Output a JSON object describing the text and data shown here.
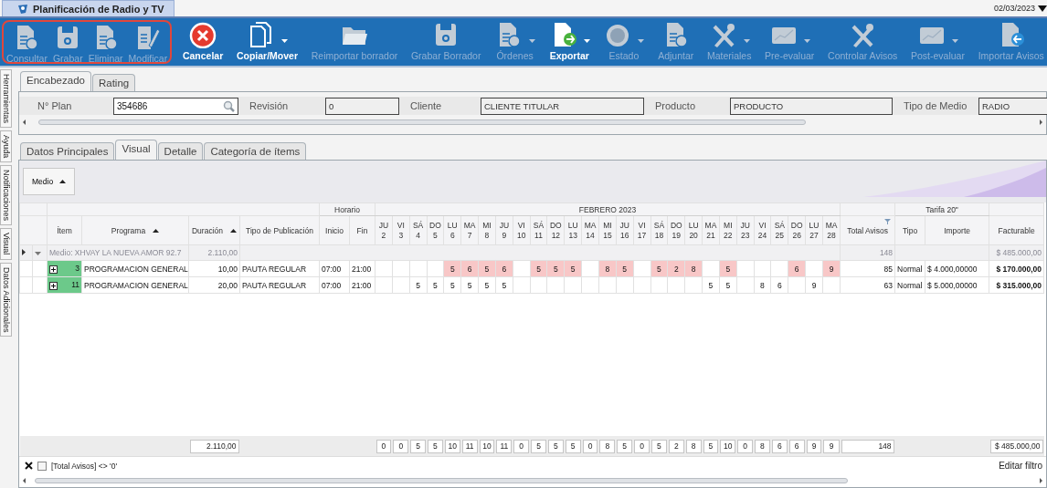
{
  "window": {
    "title": "Planificación de Radio y TV",
    "date": "02/03/2023"
  },
  "toolbar": [
    {
      "label": "Consultar",
      "enabled": false,
      "dropdown": false,
      "highlighted": true
    },
    {
      "label": "Grabar",
      "enabled": false,
      "dropdown": false,
      "highlighted": true
    },
    {
      "label": "Eliminar",
      "enabled": false,
      "dropdown": false,
      "highlighted": true
    },
    {
      "label": "Modificar",
      "enabled": false,
      "dropdown": false,
      "highlighted": true
    },
    {
      "label": "Cancelar",
      "enabled": true,
      "dropdown": false,
      "highlighted": false
    },
    {
      "label": "Copiar/Mover",
      "enabled": true,
      "dropdown": true,
      "highlighted": false
    },
    {
      "label": "Reimportar borrador",
      "enabled": false,
      "dropdown": false,
      "highlighted": false
    },
    {
      "label": "Grabar Borrador",
      "enabled": false,
      "dropdown": false,
      "highlighted": false
    },
    {
      "label": "Órdenes",
      "enabled": false,
      "dropdown": true,
      "highlighted": false
    },
    {
      "label": "Exportar",
      "enabled": true,
      "dropdown": true,
      "highlighted": false
    },
    {
      "label": "Estado",
      "enabled": false,
      "dropdown": true,
      "highlighted": false
    },
    {
      "label": "Adjuntar",
      "enabled": false,
      "dropdown": false,
      "highlighted": false
    },
    {
      "label": "Materiales",
      "enabled": false,
      "dropdown": true,
      "highlighted": false
    },
    {
      "label": "Pre-evaluar",
      "enabled": false,
      "dropdown": true,
      "highlighted": false
    },
    {
      "label": "Controlar Avisos",
      "enabled": false,
      "dropdown": false,
      "highlighted": false
    },
    {
      "label": "Post-evaluar",
      "enabled": false,
      "dropdown": true,
      "highlighted": false
    },
    {
      "label": "Importar Avisos",
      "enabled": false,
      "dropdown": false,
      "highlighted": false
    }
  ],
  "side_tabs": [
    "Herramientas",
    "Ayuda",
    "Notificaciones",
    "Visual",
    "Datos Adicionales"
  ],
  "header_tabs": [
    {
      "label": "Encabezado",
      "selected": true
    },
    {
      "label": "Rating",
      "selected": false
    }
  ],
  "header_fields": [
    {
      "label": "N° Plan",
      "value": "354686",
      "editable": true
    },
    {
      "label": "Revisión",
      "value": "0",
      "editable": false
    },
    {
      "label": "Cliente",
      "value": "CLIENTE TITULAR",
      "editable": false
    },
    {
      "label": "Producto",
      "value": "PRODUCTO",
      "editable": false
    },
    {
      "label": "Tipo de Medio",
      "value": "RADIO",
      "editable": false
    }
  ],
  "detail_tabs": [
    {
      "label": "Datos Principales",
      "selected": false
    },
    {
      "label": "Visual",
      "selected": true
    },
    {
      "label": "Detalle",
      "selected": false
    },
    {
      "label": "Categoría de ítems",
      "selected": false
    }
  ],
  "grid": {
    "group_button": {
      "label": "Medio",
      "sorted": true
    },
    "bands": {
      "horario": "Horario",
      "month": "FEBRERO 2023",
      "tarifa": "Tarifa 20\""
    },
    "lead_columns": [
      {
        "label": "Ítem",
        "sorted": false
      },
      {
        "label": "Programa",
        "sorted": true
      },
      {
        "label": "Duración",
        "sorted": true
      },
      {
        "label": "Tipo de Publicación",
        "sorted": false
      },
      {
        "label": "Inicio",
        "sorted": false
      },
      {
        "label": "Fin",
        "sorted": false
      }
    ],
    "days": [
      {
        "weekday": "JU",
        "day": "2"
      },
      {
        "weekday": "VI",
        "day": "3"
      },
      {
        "weekday": "SÁ",
        "day": "4"
      },
      {
        "weekday": "DO",
        "day": "5"
      },
      {
        "weekday": "LU",
        "day": "6"
      },
      {
        "weekday": "MA",
        "day": "7"
      },
      {
        "weekday": "MI",
        "day": "8"
      },
      {
        "weekday": "JU",
        "day": "9"
      },
      {
        "weekday": "VI",
        "day": "10"
      },
      {
        "weekday": "SÁ",
        "day": "11"
      },
      {
        "weekday": "DO",
        "day": "12"
      },
      {
        "weekday": "LU",
        "day": "13"
      },
      {
        "weekday": "MA",
        "day": "14"
      },
      {
        "weekday": "MI",
        "day": "15"
      },
      {
        "weekday": "JU",
        "day": "16"
      },
      {
        "weekday": "VI",
        "day": "17"
      },
      {
        "weekday": "SÁ",
        "day": "18"
      },
      {
        "weekday": "DO",
        "day": "19"
      },
      {
        "weekday": "LU",
        "day": "20"
      },
      {
        "weekday": "MA",
        "day": "21"
      },
      {
        "weekday": "MI",
        "day": "22"
      },
      {
        "weekday": "JU",
        "day": "23"
      },
      {
        "weekday": "VI",
        "day": "24"
      },
      {
        "weekday": "SÁ",
        "day": "25"
      },
      {
        "weekday": "DO",
        "day": "26"
      },
      {
        "weekday": "LU",
        "day": "27"
      },
      {
        "weekday": "MA",
        "day": "28"
      }
    ],
    "trail_columns": [
      {
        "label": "Total Avisos",
        "filtered": true
      },
      {
        "label": "Tipo",
        "filtered": false
      },
      {
        "label": "Importe",
        "filtered": false
      },
      {
        "label": "Facturable",
        "filtered": false
      }
    ],
    "group": {
      "label": "Medio: XHVAY LA NUEVA AMOR 92.7",
      "duracion": "2.110,00",
      "total_avisos": "148",
      "facturable": "$ 485.000,00",
      "expanded": true,
      "current": true
    },
    "rows": [
      {
        "item": "3",
        "programa": "PROGRAMACION GENERAL",
        "duracion": "10,00",
        "tipo_publicacion": "PAUTA REGULAR",
        "inicio": "07:00",
        "fin": "21:00",
        "days": [
          {
            "highlighted": false
          },
          {
            "highlighted": false
          },
          {
            "highlighted": false
          },
          {
            "highlighted": false
          },
          {
            "value": "5",
            "highlighted": true
          },
          {
            "value": "6",
            "highlighted": true
          },
          {
            "value": "5",
            "highlighted": true
          },
          {
            "value": "6",
            "highlighted": true
          },
          {
            "highlighted": false
          },
          {
            "value": "5",
            "highlighted": true
          },
          {
            "value": "5",
            "highlighted": true
          },
          {
            "value": "5",
            "highlighted": true
          },
          {
            "highlighted": false
          },
          {
            "value": "8",
            "highlighted": true
          },
          {
            "value": "5",
            "highlighted": true
          },
          {
            "highlighted": false
          },
          {
            "value": "5",
            "highlighted": true
          },
          {
            "value": "2",
            "highlighted": true
          },
          {
            "value": "8",
            "highlighted": true
          },
          {
            "highlighted": false
          },
          {
            "value": "5",
            "highlighted": true
          },
          {
            "highlighted": false
          },
          {
            "highlighted": false
          },
          {
            "highlighted": false
          },
          {
            "value": "6",
            "highlighted": true
          },
          {
            "highlighted": false
          },
          {
            "value": "9",
            "highlighted": true
          }
        ],
        "total_avisos": "85",
        "tipo": "Normal",
        "importe": "$ 4.000,00000",
        "facturable": "$ 170.000,00"
      },
      {
        "item": "11",
        "programa": "PROGRAMACION GENERAL",
        "duracion": "20,00",
        "tipo_publicacion": "PAUTA REGULAR",
        "inicio": "07:00",
        "fin": "21:00",
        "days": [
          {
            "highlighted": false
          },
          {
            "highlighted": false
          },
          {
            "value": "5",
            "highlighted": false
          },
          {
            "value": "5",
            "highlighted": false
          },
          {
            "value": "5",
            "highlighted": false
          },
          {
            "value": "5",
            "highlighted": false
          },
          {
            "value": "5",
            "highlighted": false
          },
          {
            "value": "5",
            "highlighted": false
          },
          {
            "highlighted": false
          },
          {
            "highlighted": false
          },
          {
            "highlighted": false
          },
          {
            "highlighted": false
          },
          {
            "highlighted": false
          },
          {
            "highlighted": false
          },
          {
            "highlighted": false
          },
          {
            "highlighted": false
          },
          {
            "highlighted": false
          },
          {
            "highlighted": false
          },
          {
            "highlighted": false
          },
          {
            "value": "5",
            "highlighted": false
          },
          {
            "value": "5",
            "highlighted": false
          },
          {
            "highlighted": false
          },
          {
            "value": "8",
            "highlighted": false
          },
          {
            "value": "6",
            "highlighted": false
          },
          {
            "highlighted": false
          },
          {
            "value": "9",
            "highlighted": false
          },
          {
            "highlighted": false
          }
        ],
        "total_avisos": "63",
        "tipo": "Normal",
        "importe": "$ 5.000,00000",
        "facturable": "$ 315.000,00"
      }
    ],
    "totals": {
      "duracion": "2.110,00",
      "days": [
        "0",
        "0",
        "5",
        "5",
        "10",
        "11",
        "10",
        "11",
        "0",
        "5",
        "5",
        "5",
        "0",
        "8",
        "5",
        "0",
        "5",
        "2",
        "8",
        "5",
        "10",
        "0",
        "8",
        "6",
        "6",
        "9",
        "9"
      ],
      "total_avisos": "148",
      "facturable": "$ 485.000,00"
    }
  },
  "filter": {
    "enabled": false,
    "text": "[Total Avisos] <> '0'",
    "edit_label": "Editar filtro"
  }
}
